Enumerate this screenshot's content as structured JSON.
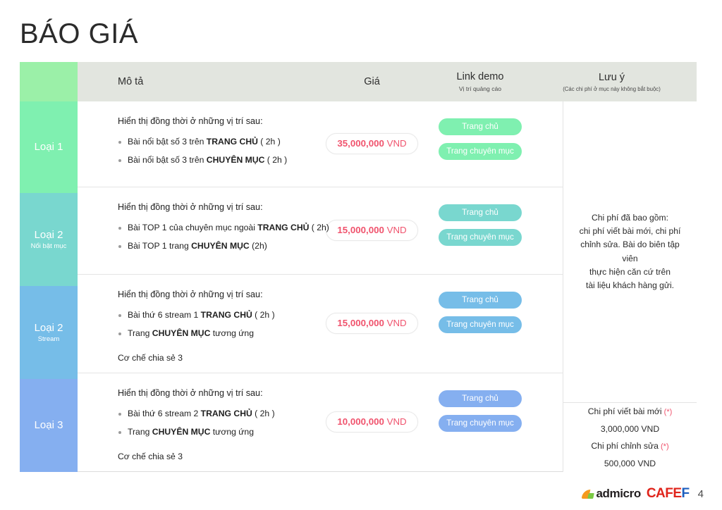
{
  "title": "BÁO GIÁ",
  "header": {
    "description": "Mô tả",
    "price": "Giá",
    "link_demo": "Link demo",
    "link_demo_sub": "Vị trí quảng cáo",
    "note": "Lưu ý",
    "note_sub": "(Các chi phí ở mục này không bắt buộc)"
  },
  "colors": {
    "header_cat": "#9bf0a8",
    "row1": "#7ff0b0",
    "row2": "#79d7cf",
    "row3": "#76bde8",
    "row4": "#85aff0",
    "price_text": "#f0536d",
    "header_bg": "#e2e5df"
  },
  "rows": [
    {
      "category": "Loại 1",
      "category_sub": "",
      "color": "#7ff0b0",
      "intro": "Hiển thị đồng thời ở những vị trí sau:",
      "bullets": [
        {
          "pre": "Bài nổi bật số 3 trên ",
          "strong": "TRANG CHỦ",
          "post": " ( 2h )"
        },
        {
          "pre": "Bài nổi bật số 3 trên ",
          "strong": "CHUYÊN MỤC",
          "post": " ( 2h )"
        }
      ],
      "footnote": "",
      "price_amount": "35,000,000",
      "price_currency": "VND",
      "btn_home": "Trang chủ",
      "btn_category": "Trang chuyên mục"
    },
    {
      "category": "Loại 2",
      "category_sub": "Nổi bật mục",
      "color": "#79d7cf",
      "intro": "Hiển thị đồng thời ở những vị trí sau:",
      "bullets": [
        {
          "pre": "Bài TOP 1 của chuyên mục ngoài ",
          "strong": "TRANG CHỦ",
          "post": " ( 2h)"
        },
        {
          "pre": "Bài TOP 1 trang ",
          "strong": "CHUYÊN MỤC",
          "post": " (2h)"
        }
      ],
      "footnote": "",
      "price_amount": "15,000,000",
      "price_currency": "VND",
      "btn_home": "Trang chủ",
      "btn_category": "Trang chuyên mục"
    },
    {
      "category": "Loại 2",
      "category_sub": "Stream",
      "color": "#76bde8",
      "intro": "Hiển thị đồng thời ở những vị trí sau:",
      "bullets": [
        {
          "pre": "Bài thứ 6 stream 1 ",
          "strong": "TRANG CHỦ",
          "post": " ( 2h )"
        },
        {
          "pre": "Trang ",
          "strong": "CHUYÊN MỤC",
          "post": " tương ứng"
        }
      ],
      "footnote": "Cơ chế chia sẻ 3",
      "price_amount": "15,000,000",
      "price_currency": "VND",
      "btn_home": "Trang chủ",
      "btn_category": "Trang chuyên mục"
    },
    {
      "category": "Loại 3",
      "category_sub": "",
      "color": "#85aff0",
      "intro": "Hiển thị đồng thời ở những vị trí sau:",
      "bullets": [
        {
          "pre": "Bài thứ 6 stream 2 ",
          "strong": "TRANG CHỦ",
          "post": "  ( 2h )"
        },
        {
          "pre": "Trang ",
          "strong": "CHUYÊN MỤC",
          "post": " tương ứng"
        }
      ],
      "footnote": "Cơ chế chia sẻ 3",
      "price_amount": "10,000,000",
      "price_currency": "VND",
      "btn_home": "Trang chủ",
      "btn_category": "Trang chuyên mục"
    }
  ],
  "notes": {
    "row1_lines": [
      "Chi phí đã bao gồm:",
      "chi phí viết bài mới, chi phí",
      "chỉnh sửa. Bài do biên tập viên",
      "thực hiện căn cứ trên",
      "tài liệu khách hàng gửi."
    ],
    "merged_lines": [
      {
        "text": "Chi phí viết bài mới",
        "star": "(*)"
      },
      {
        "text": "3,000,000 VND",
        "star": ""
      },
      {
        "text": "Chi phí chỉnh sửa",
        "star": "(*)"
      },
      {
        "text": "500,000 VND",
        "star": ""
      }
    ]
  },
  "footer": {
    "admicro": "admicro",
    "cafe": "CAFE",
    "f": "F",
    "page_number": "4"
  }
}
